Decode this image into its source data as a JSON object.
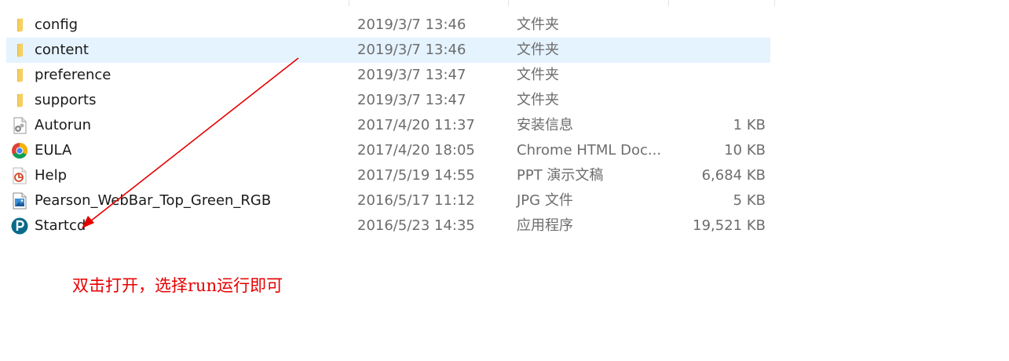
{
  "files": [
    {
      "name": "config",
      "modified": "2019/3/7 13:46",
      "type": "文件夹",
      "size": "",
      "icon": "folder-icon",
      "selected": false
    },
    {
      "name": "content",
      "modified": "2019/3/7 13:46",
      "type": "文件夹",
      "size": "",
      "icon": "folder-icon",
      "selected": true
    },
    {
      "name": "preference",
      "modified": "2019/3/7 13:47",
      "type": "文件夹",
      "size": "",
      "icon": "folder-icon",
      "selected": false
    },
    {
      "name": "supports",
      "modified": "2019/3/7 13:47",
      "type": "文件夹",
      "size": "",
      "icon": "folder-icon",
      "selected": false
    },
    {
      "name": "Autorun",
      "modified": "2017/4/20 11:37",
      "type": "安装信息",
      "size": "1 KB",
      "icon": "setup-info-icon",
      "selected": false
    },
    {
      "name": "EULA",
      "modified": "2017/4/20 18:05",
      "type": "Chrome HTML Doc...",
      "size": "10 KB",
      "icon": "chrome-icon",
      "selected": false
    },
    {
      "name": "Help",
      "modified": "2017/5/19 14:55",
      "type": "PPT 演示文稿",
      "size": "6,684 KB",
      "icon": "powerpoint-icon",
      "selected": false
    },
    {
      "name": "Pearson_WebBar_Top_Green_RGB",
      "modified": "2016/5/17 11:12",
      "type": "JPG 文件",
      "size": "5 KB",
      "icon": "image-file-icon",
      "selected": false
    },
    {
      "name": "Startcd",
      "modified": "2016/5/23 14:35",
      "type": "应用程序",
      "size": "19,521 KB",
      "icon": "pearson-app-icon",
      "selected": false
    }
  ],
  "annotation": {
    "text": "双击打开，选择run运行即可",
    "color": "#e60000"
  },
  "colors": {
    "selection": "#e5f3ff",
    "folder": "#f2c14e",
    "chrome_red": "#db4437",
    "chrome_yellow": "#f4b400",
    "chrome_green": "#0f9d58",
    "chrome_blue": "#4285f4",
    "powerpoint": "#d24726",
    "pearson": "#0a6a8a"
  }
}
